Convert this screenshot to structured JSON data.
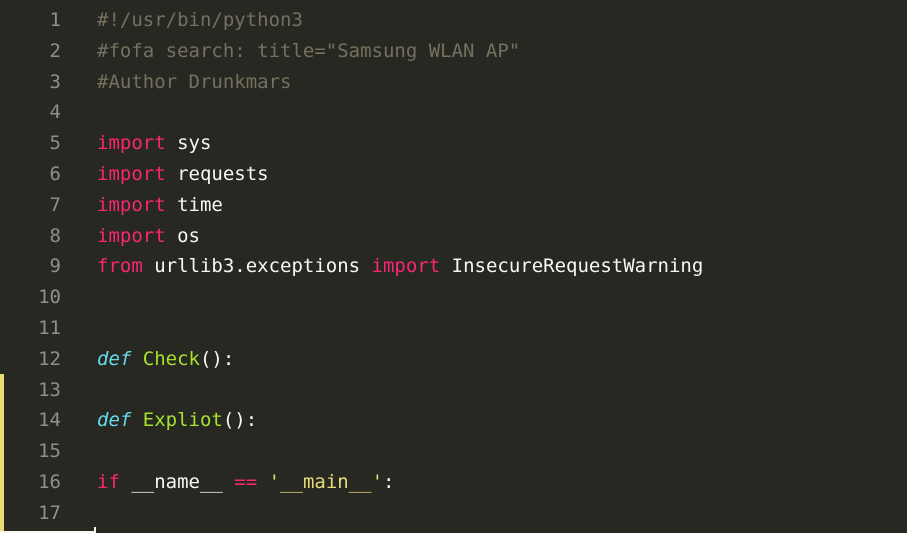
{
  "editor": {
    "theme": {
      "background": "#272822",
      "comment": "#75715e",
      "keyword": "#f92672",
      "def": "#66d9ef",
      "function": "#a6e22e",
      "string": "#e6db74",
      "text": "#f8f8f2",
      "line_number": "#90908a",
      "modified_marker": "#e6db74"
    },
    "lines": [
      {
        "n": "1",
        "tokens": [
          {
            "t": "comment",
            "v": "#!/usr/bin/python3"
          }
        ]
      },
      {
        "n": "2",
        "tokens": [
          {
            "t": "comment",
            "v": "#fofa search: title=\"Samsung WLAN AP\""
          }
        ]
      },
      {
        "n": "3",
        "tokens": [
          {
            "t": "comment",
            "v": "#Author Drunkmars"
          }
        ]
      },
      {
        "n": "4",
        "tokens": []
      },
      {
        "n": "5",
        "tokens": [
          {
            "t": "keyword",
            "v": "import"
          },
          {
            "t": "plain",
            "v": " sys"
          }
        ]
      },
      {
        "n": "6",
        "tokens": [
          {
            "t": "keyword",
            "v": "import"
          },
          {
            "t": "plain",
            "v": " requests"
          }
        ]
      },
      {
        "n": "7",
        "tokens": [
          {
            "t": "keyword",
            "v": "import"
          },
          {
            "t": "plain",
            "v": " time"
          }
        ]
      },
      {
        "n": "8",
        "tokens": [
          {
            "t": "keyword",
            "v": "import"
          },
          {
            "t": "plain",
            "v": " os"
          }
        ]
      },
      {
        "n": "9",
        "tokens": [
          {
            "t": "keyword",
            "v": "from"
          },
          {
            "t": "plain",
            "v": " urllib3.exceptions "
          },
          {
            "t": "keyword",
            "v": "import"
          },
          {
            "t": "plain",
            "v": " InsecureRequestWarning"
          }
        ]
      },
      {
        "n": "10",
        "tokens": []
      },
      {
        "n": "11",
        "tokens": []
      },
      {
        "n": "12",
        "tokens": [
          {
            "t": "def",
            "v": "def"
          },
          {
            "t": "plain",
            "v": " "
          },
          {
            "t": "func",
            "v": "Check"
          },
          {
            "t": "plain",
            "v": "():"
          }
        ]
      },
      {
        "n": "13",
        "tokens": []
      },
      {
        "n": "14",
        "tokens": [
          {
            "t": "def",
            "v": "def"
          },
          {
            "t": "plain",
            "v": " "
          },
          {
            "t": "func",
            "v": "Expliot"
          },
          {
            "t": "plain",
            "v": "():"
          }
        ]
      },
      {
        "n": "15",
        "tokens": []
      },
      {
        "n": "16",
        "tokens": [
          {
            "t": "keyword",
            "v": "if"
          },
          {
            "t": "plain",
            "v": " __name__ "
          },
          {
            "t": "op",
            "v": "=="
          },
          {
            "t": "plain",
            "v": " "
          },
          {
            "t": "string",
            "v": "'__main__'"
          },
          {
            "t": "plain",
            "v": ":"
          }
        ]
      },
      {
        "n": "17",
        "tokens": []
      }
    ],
    "modified_lines": [
      "13",
      "14",
      "15",
      "16",
      "17"
    ]
  }
}
